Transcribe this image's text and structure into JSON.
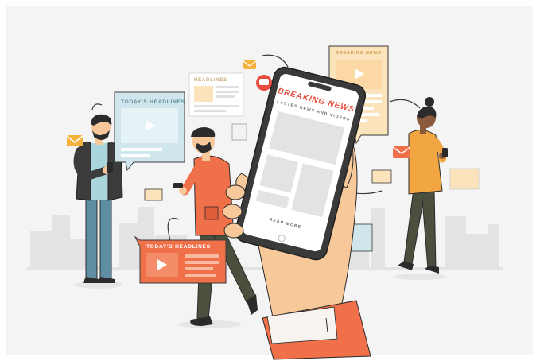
{
  "phone": {
    "title": "BREAKING NEWS",
    "subtitle": "LASTES NEWS AND VIDEOS",
    "read_more": "READ MORE"
  },
  "bubbles": {
    "todays_headlines_blue": "TODAY'S HEADLINES",
    "todays_headlines_orange": "TODAY'S HEADLINES",
    "headlines": "HEADLINES",
    "breaking_news_card": "BREAKING NEWS"
  },
  "colors": {
    "background": "#f4f4f4",
    "skyline": "#e3e3e3",
    "accent_red": "#e74c3c",
    "accent_orange": "#f0704a",
    "light_blue": "#cfe6ec",
    "cream": "#fbe3bb",
    "skin": "#f6c89a",
    "dark": "#2b2b2b"
  },
  "icons": [
    "play-icon",
    "mail-icon",
    "chat-icon"
  ]
}
